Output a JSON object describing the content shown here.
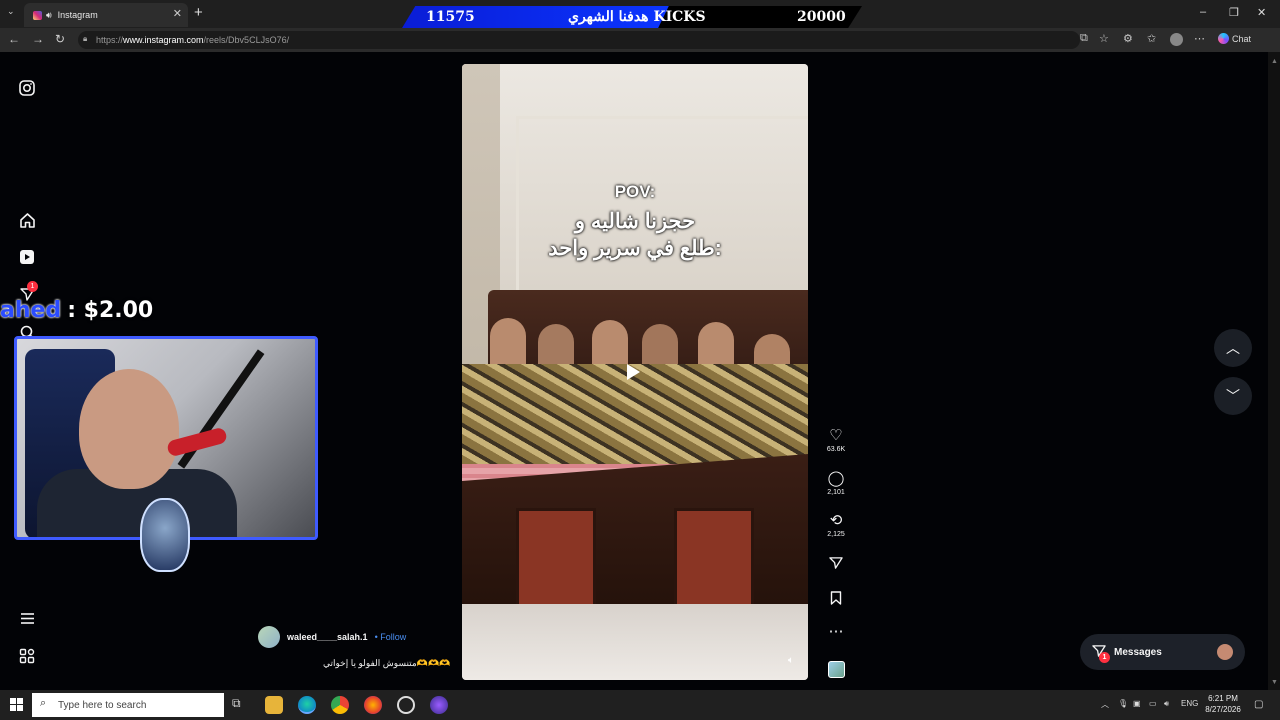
{
  "browser": {
    "tab_title": "Instagram",
    "url_prefix": "https://",
    "url_host": "www.instagram.com",
    "url_path": "/reels/Dbv5CLJsO76/",
    "chat_label": "Chat"
  },
  "banner": {
    "current": "11575",
    "goal_text": "هدفنا الشهري KICKS",
    "target": "20000"
  },
  "donation": {
    "name": "ahed",
    "amount": ": $2.00"
  },
  "reel": {
    "overlay_pov": "POV:",
    "overlay_line1": "حجزنا شاليه و",
    "overlay_line2": "طلع في سرير واحد:",
    "author": "waleed____salah.1",
    "follow_label": "• Follow",
    "caption": "متنسوش الفولو يا إخواتي🫶🫶🫶",
    "likes": "63.6K",
    "comments": "2,101",
    "reposts": "2,125"
  },
  "sidebar": {
    "notification_badge": "1"
  },
  "messages": {
    "label": "Messages",
    "badge": "1"
  },
  "taskbar": {
    "search_placeholder": "Type here to search",
    "lang": "ENG",
    "time": "6:21 PM",
    "date": "8/27/2026"
  },
  "colors": {
    "page_bg": "#020306",
    "banner_fill": "#0b35ff",
    "follow_link": "#4a8ef0",
    "badge_red": "#ff3040",
    "webcam_border": "#3f5bff"
  }
}
